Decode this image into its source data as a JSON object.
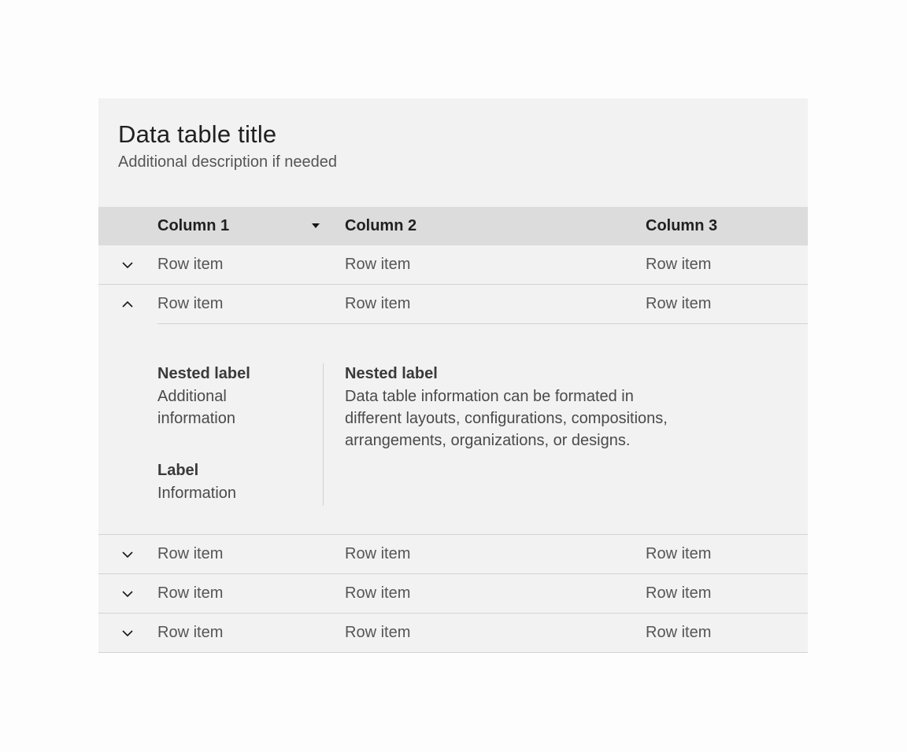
{
  "table": {
    "title": "Data table title",
    "description": "Additional description if needed",
    "columns": [
      "Column 1",
      "Column 2",
      "Column 3"
    ],
    "rows": [
      {
        "cells": [
          "Row item",
          "Row item",
          "Row item"
        ],
        "expanded": false
      },
      {
        "cells": [
          "Row item",
          "Row item",
          "Row item"
        ],
        "expanded": true
      },
      {
        "cells": [
          "Row item",
          "Row item",
          "Row item"
        ],
        "expanded": false
      },
      {
        "cells": [
          "Row item",
          "Row item",
          "Row item"
        ],
        "expanded": false
      },
      {
        "cells": [
          "Row item",
          "Row item",
          "Row item"
        ],
        "expanded": false
      }
    ],
    "expansion": {
      "left": [
        {
          "label": "Nested label",
          "value_lines": [
            "Additional",
            "information"
          ]
        },
        {
          "label": "Label",
          "value_lines": [
            "Information"
          ]
        }
      ],
      "right": {
        "label": "Nested label",
        "value_lines": [
          "Data table information can be formated in",
          "different layouts, configurations, compositions,",
          "arrangements, organizations, or designs."
        ]
      }
    },
    "icons": {
      "sort": "caret-down-icon",
      "expand": "chevron-down-icon",
      "collapse": "chevron-up-icon"
    }
  }
}
